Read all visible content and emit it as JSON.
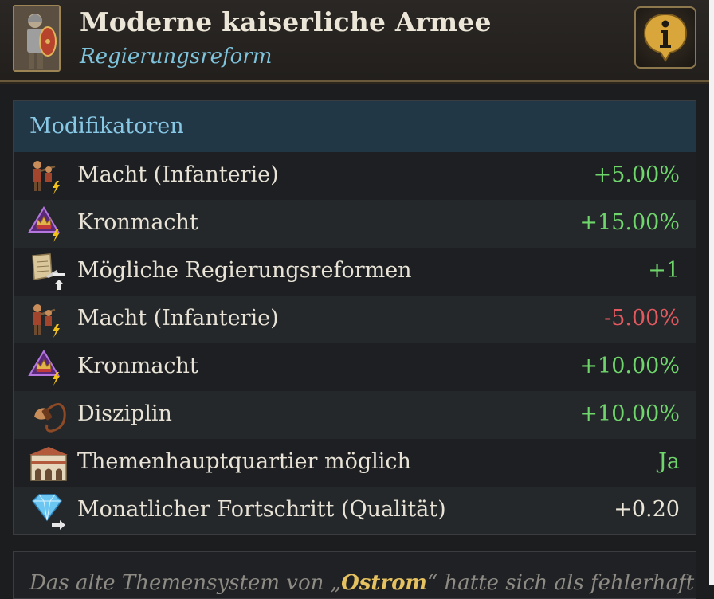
{
  "header": {
    "title": "Moderne kaiserliche Armee",
    "subtitle": "Regierungsreform",
    "portrait_icon": "soldier-portrait-icon",
    "info_icon": "info-icon"
  },
  "modifiers": {
    "heading": "Modifikatoren",
    "rows": [
      {
        "icon": "infantry-icon",
        "label": "Macht (Infanterie)",
        "value": "+5.00%",
        "tone": "positive"
      },
      {
        "icon": "crown-power-icon",
        "label": "Kronmacht",
        "value": "+15.00%",
        "tone": "positive"
      },
      {
        "icon": "scroll-reform-icon",
        "label": "Mögliche Regierungsreformen",
        "value": "+1",
        "tone": "positive"
      },
      {
        "icon": "infantry-icon",
        "label": "Macht (Infanterie)",
        "value": "-5.00%",
        "tone": "negative"
      },
      {
        "icon": "crown-power-icon",
        "label": "Kronmacht",
        "value": "+10.00%",
        "tone": "positive"
      },
      {
        "icon": "whip-discipline-icon",
        "label": "Disziplin",
        "value": "+10.00%",
        "tone": "positive"
      },
      {
        "icon": "building-hq-icon",
        "label": "Themenhauptquartier möglich",
        "value": "Ja",
        "tone": "positive"
      },
      {
        "icon": "diamond-quality-icon",
        "label": "Monatlicher Fortschritt (Qualität)",
        "value": "+0.20",
        "tone": "neutral"
      }
    ]
  },
  "description": {
    "before": "Das alte Themensystem von „",
    "highlight": "Ostrom",
    "after": "“ hatte sich als fehlerhaft"
  },
  "colors": {
    "positive": "#6fd66b",
    "negative": "#e1595f",
    "neutral": "#ece6d8",
    "heading": "#88c8e4",
    "highlight": "#e5c160"
  }
}
